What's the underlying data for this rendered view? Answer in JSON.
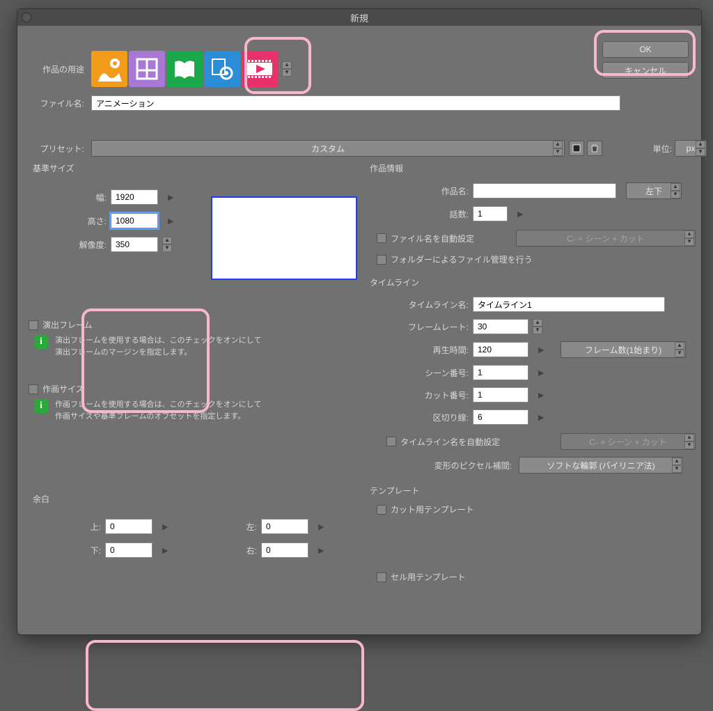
{
  "title": "新規",
  "purpose": {
    "label": "作品の用途"
  },
  "filename": {
    "label": "ファイル名:",
    "value": "アニメーション"
  },
  "preset": {
    "label": "プリセット:",
    "value": "カスタム"
  },
  "unit": {
    "label": "単位:",
    "value": "px"
  },
  "size": {
    "title": "基準サイズ",
    "width": {
      "label": "幅:",
      "value": "1920"
    },
    "height": {
      "label": "高さ:",
      "value": "1080"
    },
    "dpi": {
      "label": "解像度:",
      "value": "350"
    }
  },
  "direction_frame": {
    "title": "演出フレーム",
    "hint": "演出フレームを使用する場合は、このチェックをオンにして\n演出フレームのマージンを指定します。"
  },
  "draw_size": {
    "title": "作画サイズ",
    "hint": "作画フレームを使用する場合は、このチェックをオンにして\n作画サイズや基準フレームのオフセットを指定します。"
  },
  "margin": {
    "title": "余白",
    "top": {
      "label": "上:",
      "value": "0"
    },
    "bottom": {
      "label": "下:",
      "value": "0"
    },
    "left": {
      "label": "左:",
      "value": "0"
    },
    "right": {
      "label": "右:",
      "value": "0"
    }
  },
  "work_info": {
    "title": "作品情報",
    "name": {
      "label": "作品名:",
      "value": ""
    },
    "episode": {
      "label": "話数:",
      "value": "1"
    },
    "pos": {
      "label": "左下"
    },
    "auto_filename": "ファイル名を自動設定",
    "auto_filename_pattern": "C- + シーン + カット",
    "folder_manage": "フォルダーによるファイル管理を行う"
  },
  "timeline": {
    "title": "タイムライン",
    "name": {
      "label": "タイムライン名:",
      "value": "タイムライン1"
    },
    "fps": {
      "label": "フレームレート:",
      "value": "30"
    },
    "play": {
      "label": "再生時間:",
      "value": "120",
      "framecount_label": "フレーム数(1始まり)"
    },
    "scene": {
      "label": "シーン番号:",
      "value": "1"
    },
    "cut": {
      "label": "カット番号:",
      "value": "1"
    },
    "sep": {
      "label": "区切り線:",
      "value": "6"
    },
    "auto_name": "タイムライン名を自動設定",
    "auto_name_pattern": "C- + シーン + カット",
    "interp": {
      "label": "変形のピクセル補間:",
      "value": "ソフトな輪郭 (バイリニア法)"
    }
  },
  "template": {
    "title": "テンプレート",
    "cut": "カット用テンプレート",
    "cell": "セル用テンプレート"
  },
  "buttons": {
    "ok": "OK",
    "cancel": "キャンセル"
  }
}
